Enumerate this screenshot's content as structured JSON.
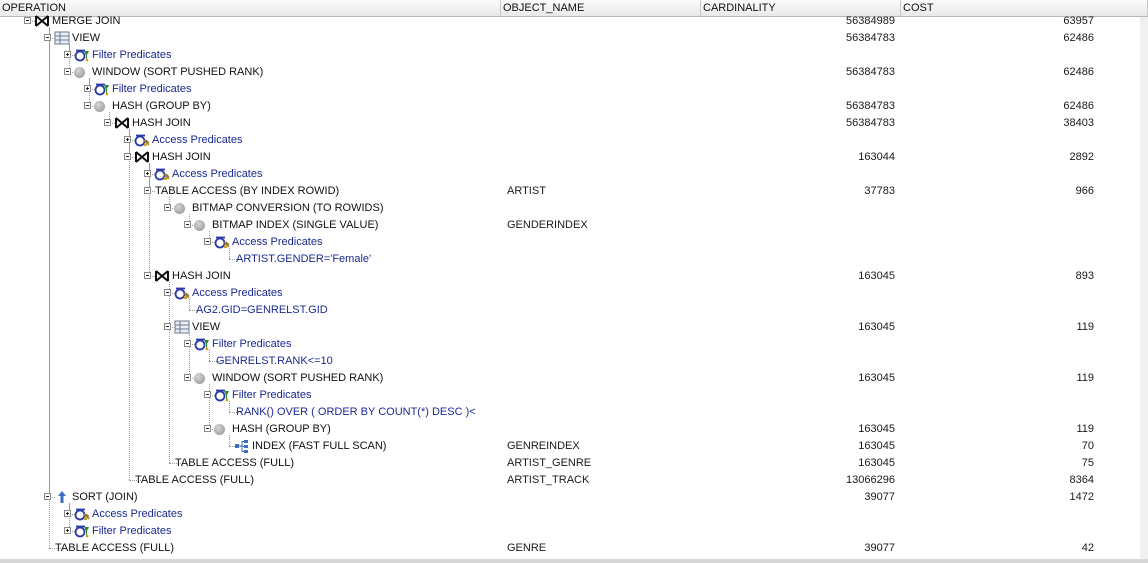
{
  "columns": {
    "operation": "OPERATION",
    "object_name": "OBJECT_NAME",
    "cardinality": "CARDINALITY",
    "cost": "COST"
  },
  "rows": [
    {
      "label": "MERGE JOIN",
      "object": "",
      "cardinality": "56384989",
      "cost": "63957",
      "icon": "join-icon"
    },
    {
      "label": "VIEW",
      "object": "",
      "cardinality": "56384783",
      "cost": "62486",
      "icon": "view-icon"
    },
    {
      "label": "Filter Predicates",
      "object": "",
      "cardinality": "",
      "cost": "",
      "icon": "filter-icon"
    },
    {
      "label": "WINDOW (SORT PUSHED RANK)",
      "object": "",
      "cardinality": "56384783",
      "cost": "62486",
      "icon": "operation-icon"
    },
    {
      "label": "Filter Predicates",
      "object": "",
      "cardinality": "",
      "cost": "",
      "icon": "filter-icon"
    },
    {
      "label": "HASH (GROUP BY)",
      "object": "",
      "cardinality": "56384783",
      "cost": "62486",
      "icon": "operation-icon"
    },
    {
      "label": "HASH JOIN",
      "object": "",
      "cardinality": "56384783",
      "cost": "38403",
      "icon": "join-icon"
    },
    {
      "label": "Access Predicates",
      "object": "",
      "cardinality": "",
      "cost": "",
      "icon": "access-icon"
    },
    {
      "label": "HASH JOIN",
      "object": "",
      "cardinality": "163044",
      "cost": "2892",
      "icon": "join-icon"
    },
    {
      "label": "Access Predicates",
      "object": "",
      "cardinality": "",
      "cost": "",
      "icon": "access-icon"
    },
    {
      "label": "TABLE ACCESS (BY INDEX ROWID)",
      "object": "ARTIST",
      "cardinality": "37783",
      "cost": "966",
      "icon": ""
    },
    {
      "label": "BITMAP CONVERSION (TO ROWIDS)",
      "object": "",
      "cardinality": "",
      "cost": "",
      "icon": "operation-icon"
    },
    {
      "label": "BITMAP INDEX (SINGLE VALUE)",
      "object": "GENDERINDEX",
      "cardinality": "",
      "cost": "",
      "icon": "operation-icon"
    },
    {
      "label": "Access Predicates",
      "object": "",
      "cardinality": "",
      "cost": "",
      "icon": "access-icon"
    },
    {
      "label": "ARTIST.GENDER='Female'",
      "object": "",
      "cardinality": "",
      "cost": "",
      "icon": ""
    },
    {
      "label": "HASH JOIN",
      "object": "",
      "cardinality": "163045",
      "cost": "893",
      "icon": "join-icon"
    },
    {
      "label": "Access Predicates",
      "object": "",
      "cardinality": "",
      "cost": "",
      "icon": "access-icon"
    },
    {
      "label": "AG2.GID=GENRELST.GID",
      "object": "",
      "cardinality": "",
      "cost": "",
      "icon": ""
    },
    {
      "label": "VIEW",
      "object": "",
      "cardinality": "163045",
      "cost": "119",
      "icon": "view-icon"
    },
    {
      "label": "Filter Predicates",
      "object": "",
      "cardinality": "",
      "cost": "",
      "icon": "filter-icon"
    },
    {
      "label": "GENRELST.RANK<=10",
      "object": "",
      "cardinality": "",
      "cost": "",
      "icon": ""
    },
    {
      "label": "WINDOW (SORT PUSHED RANK)",
      "object": "",
      "cardinality": "163045",
      "cost": "119",
      "icon": "operation-icon"
    },
    {
      "label": "Filter Predicates",
      "object": "",
      "cardinality": "",
      "cost": "",
      "icon": "filter-icon"
    },
    {
      "label": "RANK() OVER ( ORDER BY COUNT(*) DESC )<",
      "object": "",
      "cardinality": "",
      "cost": "",
      "icon": ""
    },
    {
      "label": "HASH (GROUP BY)",
      "object": "",
      "cardinality": "163045",
      "cost": "119",
      "icon": "operation-icon"
    },
    {
      "label": "INDEX (FAST FULL SCAN)",
      "object": "GENREINDEX",
      "cardinality": "163045",
      "cost": "70",
      "icon": "index-icon"
    },
    {
      "label": "TABLE ACCESS (FULL)",
      "object": "ARTIST_GENRE",
      "cardinality": "163045",
      "cost": "75",
      "icon": ""
    },
    {
      "label": "TABLE ACCESS (FULL)",
      "object": "ARTIST_TRACK",
      "cardinality": "13066296",
      "cost": "8364",
      "icon": ""
    },
    {
      "label": "SORT (JOIN)",
      "object": "",
      "cardinality": "39077",
      "cost": "1472",
      "icon": "sort-icon"
    },
    {
      "label": "Access Predicates",
      "object": "",
      "cardinality": "",
      "cost": "",
      "icon": "access-icon"
    },
    {
      "label": "Filter Predicates",
      "object": "",
      "cardinality": "",
      "cost": "",
      "icon": "filter-icon"
    },
    {
      "label": "TABLE ACCESS (FULL)",
      "object": "GENRE",
      "cardinality": "39077",
      "cost": "42",
      "icon": ""
    }
  ]
}
